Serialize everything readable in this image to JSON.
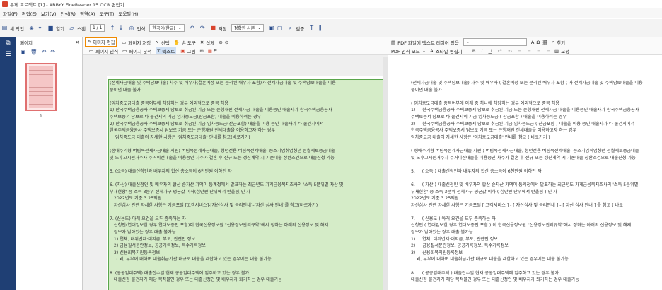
{
  "window": {
    "title": "무제 프로젝트 [1] - ABBYY FineReader 15 OCR 편집기"
  },
  "menu": [
    "파일(F)",
    "편집(E)",
    "보기(V)",
    "인식(R)",
    "영역(A)",
    "도구(T)",
    "도움말(H)"
  ],
  "toolbar": {
    "new": "새 작업",
    "open": "열기",
    "scan": "스캔",
    "page_counter": "1 / 1",
    "recognize": "인식",
    "language": "한국어(한글)",
    "save": "저장",
    "save_format": "정확한 사본",
    "verify": "검증"
  },
  "pages_panel": {
    "title": "페이지",
    "page_label": "1"
  },
  "image_panel": {
    "edit_image": "이미지 편집",
    "image_save": "페이지 저장",
    "page_recognize": "페이지 인식",
    "page_analyze": "페이지 분석",
    "select": "선택",
    "hand": "손 도구",
    "delete": "삭제",
    "text_area": "텍스트",
    "picture": "그림",
    "text": "(전세자금대출 및 주택담보대출) 차주 및 배우자(결혼예정 또는 분리된 배우자 포함)가 전세자금대출 및 주택담보대출을 이용\n중이면 대출 불가\n\n(임차중도금대출 중복여부에 해당하는 경우 예외적으로 중복 허용\n1) 한국주택금융공사 주택보증서 담보로 취급된 기금 또는 은행재원 전세자금 대출을 이용중인 대출자가 한국주택금융공사\n주택보증서 담보로 타 물건지의 기금 임차중도금(잔금포함) 대출을 이용하려는 경우\n2) 한국주택금융공사 주택보증서 담보로 취급된 기금 임차중도금(잔금포함) 대출을 이용 중인 대출자가 타 물건지에서\n한국주택금융공사 주택보증서 담보로 기금 또는 은행재원 전세대출을 이용하고자 하는 경우\n    임차중도금 대출의 자세한 사항은 '임차중도금대출' 안내를 참고(바로가기)\n\n(생애주기형 버팀목전세자금대출 지원) 버팀목전세자금대출, 청년전용 버팀목전세대출, 중소기업취업청년 전월세보증금대출\n및 노후고시원거주자 주거이전대출을 이용중인 차주가 결혼 후 신규 또는 갱신계약 시 기존대출 상환조건으로 대출신청 가능\n\n5. (소득) 대출신청인과 배우자의 합산 총소득이 6천만원 이하인 자\n\n6. (자산) 대출신청인 및 배우자의 합산 순자산 가액이 통계청에서 발표하는 최근년도 가계금융복지조사의 '소득 5분위별 자산 및\n부채현황' 중 소득 3분위 전체가구 평균값 이하(십만원 단위에서 반올림)인 자\n   2022년도 기준 3.25억원\n   자산심사 관련 자세한 사항은 기금포털 [고객서비스]-[자산심사 및 금리안내]-[자산 심사 안내]를 참고(바로가기)\n\n7. (신용도) 아래 요건을 모두 충족하는 자\n   신청인(연대입보한 경우 연대보증인 포함)이 한국신용정보원 \"신용정보관리규약\"에서 정하는 아래의 신용정보 및 해제\n   정보가 남아있는 경우 대출 불가능\n   1) 연체, 대위변제·대지급, 부도, 관련인 정보\n   2) 금융질서문란정보, 공공기록정보, 특수기록정보\n   3) 신용회복지원등록정보\n   그 외, 부부에 대하여 대출취급기관 내규로 대출을 제한하고 있는 경우에는 대출 불가능\n\n8. (공공임대주택) 대출접수일 현재 공공임대주택에 입주하고 있는 경우 불가\n   대출신청 물건지가 해당 목적물인 경우 또는 대출신청인 및 배우자가 퇴거하는 경우 대출가능\n\n9. (신혼가구) 혼인관계증명서상 신청인과 그 외 배우자 관계 혼인기간(동일한 배우자와 재혼 포함) 및 재혼한 경우 최초"
  },
  "text_panel": {
    "pdf_toolbar": "PDF 파일에 텍스트 레이어 있음",
    "pdf_mode": "PDF 인식 모드",
    "style_edit": "스타일 편집기",
    "find": "찾기",
    "correct": "교정",
    "text": "(전세자금대출 및 주택담보대출) 차주 및 배우자 ( 결혼예정 또는 분리된 배우자 포함 ) 가 전세자금대출 및 주택담보대출을 이용\n중이면 대출 불가\n\n( 임차중도금대출 중복여부에 아래 중 하나에 해당하는 경우 예외적으로 중복 허용\n1)     한국주택금융공사 주택보증서 담보로 취급된 기금 또는 은행재원 전세자금 대출을 이용중인 대출자가 한국주택금융공사\n주택보증서 담보로 타 물건지의 기금 임차중도금 ( 잔금포함 ) 대출을 이용하려는 경우\n2)     한국주택금융공사 주택보증서 담보로 취급된 기금 임차중도금 ( 잔금포함 ) 대출을 이용 중인 대출자가 타 물건지에서\n한국주택금융공사 주택보증서 담보로 기금 또는 은행재원 전세대출을 이용하고자 하는 경우\n임차중도금 대출의 자세한 사항은 '임차중도금대출' 안내를 참고 ( 바로가기 )\n\n( 생애주기형 버팀목전세자금대출 지원 ) 버팀목전세자금대출, 청년전용 버팀목전세대출, 중소기업취업청년 전월세보증금대출\n및 노후고시원거주자 주거이전대출을 이용중인 차주가 결혼 후 신규 또는 갱신계약 시 기존대출 상환조건으로 대출신청 가능\n\n5.     ( 소득 ) 대출신청인과 배우자의 합산 총소득이 6천만원 이하인 자\n\n6.     ( 자산 ) 대출신청인 및 배우자의 합산 순자산 가액이 통계청에서 발표하는 최근년도 가계금융복지조사의 '소득 5분위별\n부채현황' 중 소득 3분위 전체가구 평균값 이하 ( 십만원 단위에서 반올림 ) 인 자\n2022년도 기준 3.25억원\n자산심사 관련 자세한 사항은 기금포털 [ 고객서비스 ] - [ 자산심사 및 금리안내 ] - [ 자산 심사 안내 ] 를 참고 ( 바로\n\n7.     ( 신용도 ) 아래 요건을 모두 충족하는 자\n신청인 ( 연대입보한 경우 연대보증인 포함 ) 이 한국신용정보원 \"신용정보관리규약\"에서 정하는 아래의 신용정보 및 해제\n정보가 남아있는 경우 대출 불가능\n1)     연체, 대위변제·대지급, 부도, 관련인 정보\n2)     금융질서문란정보, 공공기록정보, 특수기록정보\n3)     신용회복지원등록정보\n그 외, 부부에 대하여 대출취급기관 내규로 대출을 제한하고 있는 경우에는 대출 불가능\n\n8.     ( 공공임대주택 ) 대출접수일 현재 공공임대주택에 입주하고 있는 경우 불가\n대출신청 물건지가 해당 목적물인 경우 또는 대출신청인 및 배우자가 퇴거하는 경우 대출가능\n\n9.     ( 신혼가구 ) 혼인관계증명서상 신청인과 그 외 배우자 관계 혼인기간 ( 동일한 배우자와 재혼 포함 ) 및 재혼한"
  }
}
